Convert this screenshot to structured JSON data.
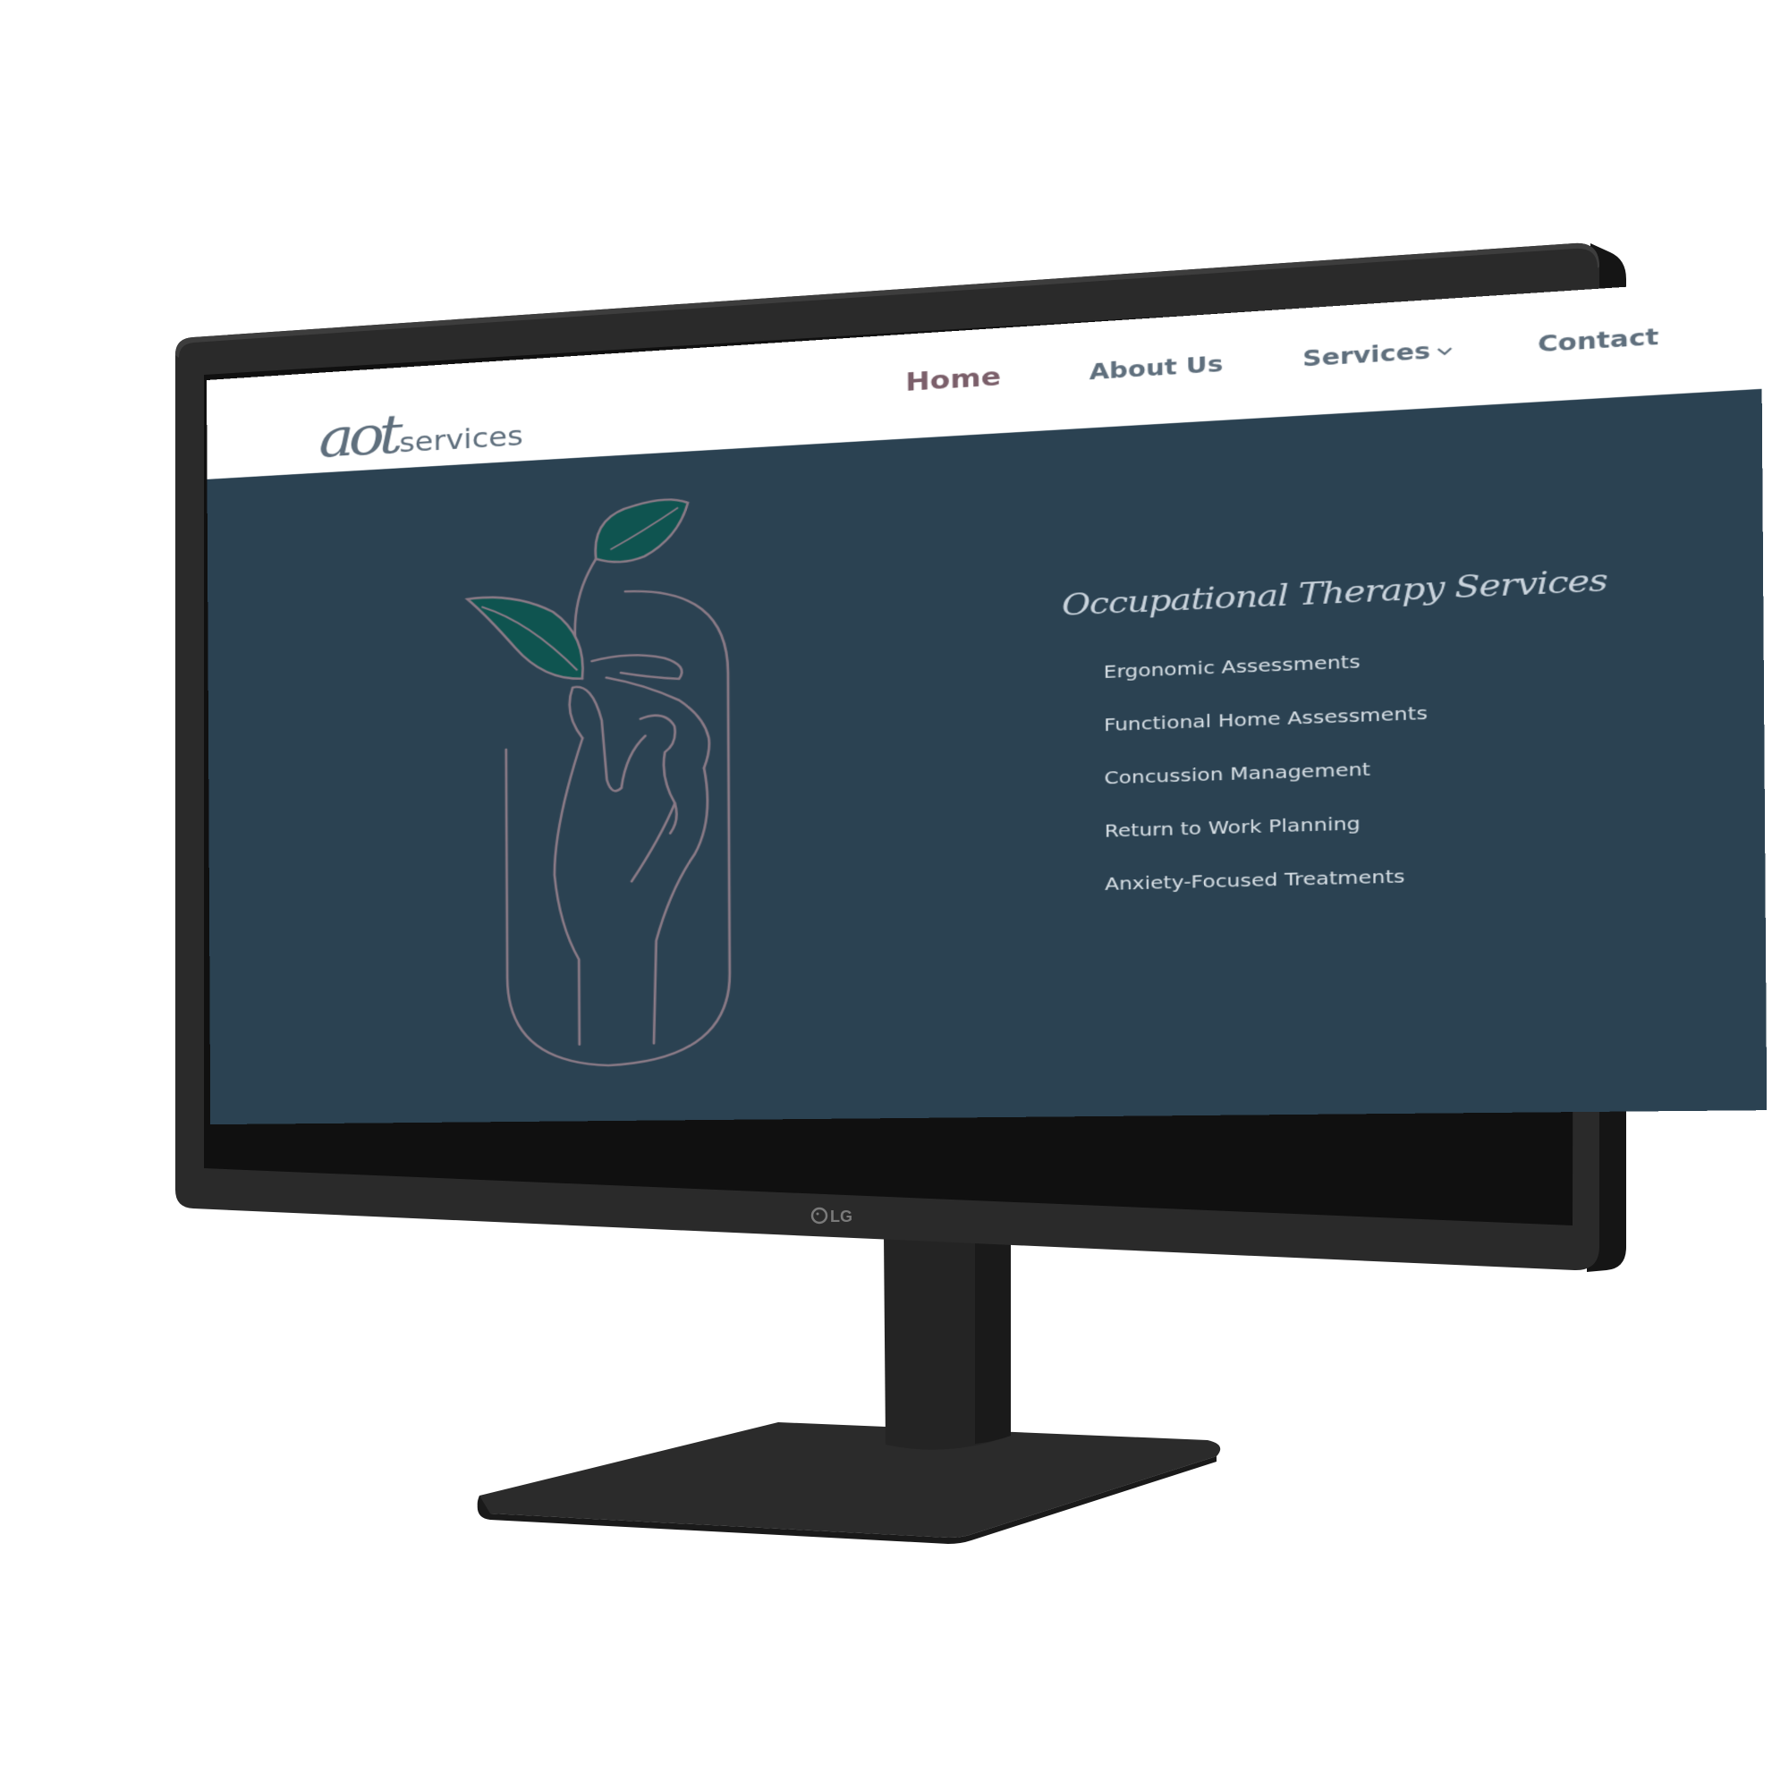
{
  "site": {
    "logo_mark": "aot",
    "logo_word": "services"
  },
  "nav": {
    "home": "Home",
    "about": "About Us",
    "services": "Services",
    "contact": "Contact"
  },
  "hero": {
    "title": "Occupational Therapy Services",
    "services": [
      "Ergonomic Assessments",
      "Functional Home Assessments",
      "Concussion Management",
      "Return to Work Planning",
      "Anxiety-Focused Treatments"
    ]
  },
  "device": {
    "brand": "LG"
  },
  "colors": {
    "hero_background": "#2b4252",
    "header_background": "#ffffff",
    "nav_active": "#7b5f6a",
    "nav_text": "#5f6f7d",
    "leaf_fill": "#0f5450",
    "line_art": "#8a7a86",
    "monitor_bezel": "#2a2a2a"
  },
  "icons": {
    "services_dropdown": "chevron-down-icon",
    "brand_logo": "lg-logo-icon",
    "hero_illustration": "hand-holding-sprout-icon"
  }
}
